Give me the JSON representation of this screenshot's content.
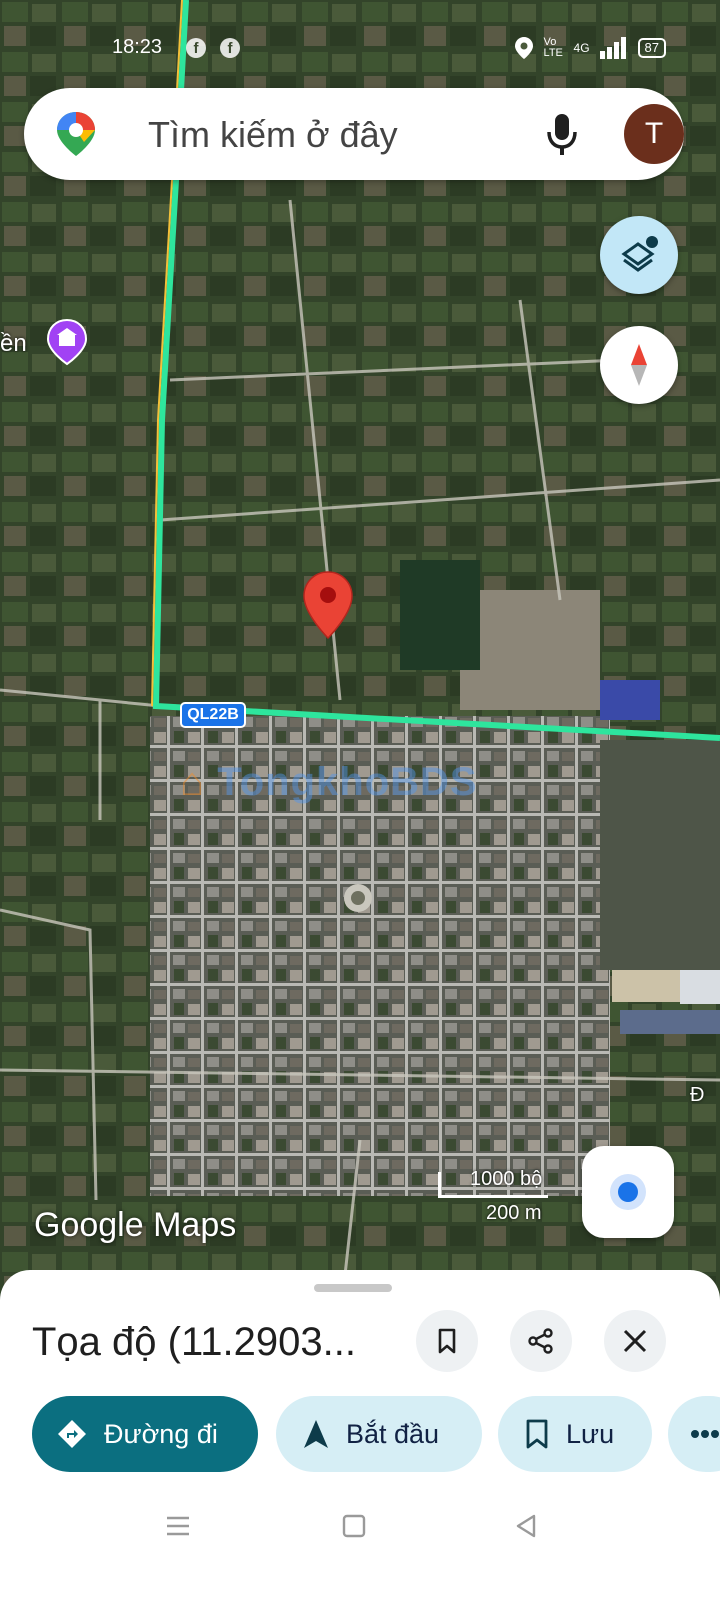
{
  "status_bar": {
    "time": "18:23",
    "icons": [
      "facebook-icon",
      "facebook-icon"
    ],
    "network_label": "Vo LTE",
    "signal_label": "4G",
    "battery": "87"
  },
  "search": {
    "placeholder": "Tìm kiếm ở đây",
    "avatar_letter": "T"
  },
  "map": {
    "road_label": "QL22B",
    "place_label_partial": "ền",
    "edge_label": "Đ",
    "watermark": "TongkhoBDS",
    "scale_feet": "1000 bộ",
    "scale_meters": "200 m",
    "logo": "Google Maps",
    "route_color": "#2ee59d",
    "pin_color": "#ea4335"
  },
  "sheet": {
    "title": "Tọa độ (11.2903...",
    "actions": {
      "directions": "Đường đi",
      "start": "Bắt đầu",
      "save": "Lưu"
    }
  }
}
